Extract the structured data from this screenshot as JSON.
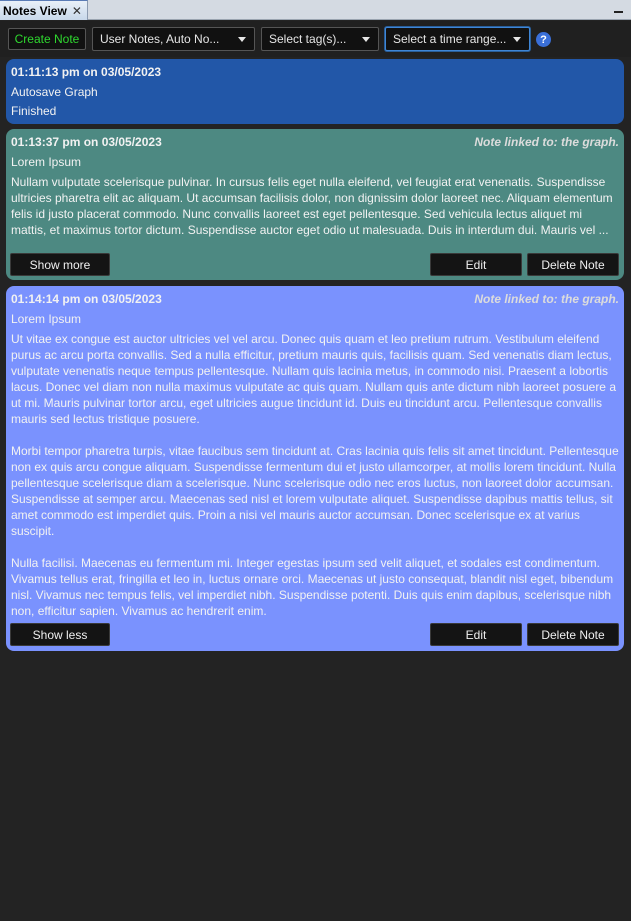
{
  "tab": {
    "title": "Notes View",
    "close_glyph": "✕"
  },
  "toolbar": {
    "create_label": "Create Note",
    "type_filter": "User Notes, Auto No...",
    "tag_filter": "Select tag(s)...",
    "time_filter": "Select a time range...",
    "help_glyph": "?"
  },
  "notes": [
    {
      "timestamp": "01:11:13 pm on 03/05/2023",
      "title": "Autosave Graph",
      "body": "Finished",
      "color": "#2257a8"
    },
    {
      "timestamp": "01:13:37 pm on 03/05/2023",
      "link": "Note linked to: the graph.",
      "title": "Lorem Ipsum",
      "body": "Nullam vulputate scelerisque pulvinar. In cursus felis eget nulla eleifend, vel feugiat erat venenatis. Suspendisse ultricies pharetra elit ac aliquam. Ut accumsan facilisis dolor, non dignissim dolor laoreet nec. Aliquam elementum felis id justo placerat commodo. Nunc convallis laoreet est eget pellentesque. Sed vehicula lectus aliquet mi mattis, et maximus tortor dictum. Suspendisse auctor eget odio ut malesuada. Duis in interdum dui. Mauris vel ...",
      "toggle_label": "Show more",
      "edit_label": "Edit",
      "delete_label": "Delete Note",
      "color": "#4d8982"
    },
    {
      "timestamp": "01:14:14 pm on 03/05/2023",
      "link": "Note linked to: the graph.",
      "title": "Lorem Ipsum",
      "body": "Ut vitae ex congue est auctor ultricies vel vel arcu. Donec quis quam et leo pretium rutrum. Vestibulum eleifend purus ac arcu porta convallis. Sed a nulla efficitur, pretium mauris quis, facilisis quam. Sed venenatis diam lectus, vulputate venenatis neque tempus pellentesque. Nullam quis lacinia metus, in commodo nisi. Praesent a lobortis lacus. Donec vel diam non nulla maximus vulputate ac quis quam. Nullam quis ante dictum nibh laoreet posuere a ut mi. Mauris pulvinar tortor arcu, eget ultricies augue tincidunt id. Duis eu tincidunt arcu. Pellentesque convallis mauris sed lectus tristique posuere.\n\nMorbi tempor pharetra turpis, vitae faucibus sem tincidunt at. Cras lacinia quis felis sit amet tincidunt. Pellentesque non ex quis arcu congue aliquam. Suspendisse fermentum dui et justo ullamcorper, at mollis lorem tincidunt. Nulla pellentesque scelerisque diam a scelerisque. Nunc scelerisque odio nec eros luctus, non laoreet dolor accumsan. Suspendisse at semper arcu. Maecenas sed nisl et lorem vulputate aliquet. Suspendisse dapibus mattis tellus, sit amet commodo est imperdiet quis. Proin a nisi vel mauris auctor accumsan. Donec scelerisque ex at varius suscipit.\n\nNulla facilisi. Maecenas eu fermentum mi. Integer egestas ipsum sed velit aliquet, et sodales est condimentum. Vivamus tellus erat, fringilla et leo in, luctus ornare orci. Maecenas ut justo consequat, blandit nisl eget, bibendum nisl. Vivamus nec tempus felis, vel imperdiet nibh. Suspendisse potenti. Duis quis enim dapibus, scelerisque nibh non, efficitur sapien. Vivamus ac hendrerit enim.",
      "toggle_label": "Show less",
      "edit_label": "Edit",
      "delete_label": "Delete Note",
      "color": "#7a92fe"
    }
  ]
}
